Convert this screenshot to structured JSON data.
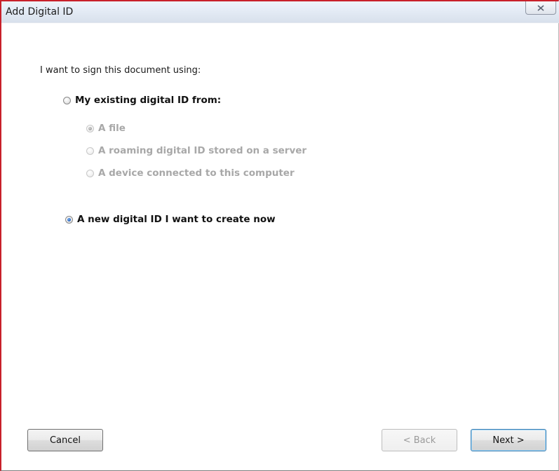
{
  "window": {
    "title": "Add Digital ID",
    "close_icon": "close-icon"
  },
  "prompt": "I want to sign this document using:",
  "options": {
    "existing": {
      "label": "My existing digital ID from:",
      "checked": false,
      "enabled": true,
      "sub_options": [
        {
          "label": "A file",
          "checked": true,
          "enabled": false
        },
        {
          "label": "A roaming digital ID stored on a server",
          "checked": false,
          "enabled": false
        },
        {
          "label": "A device connected to this computer",
          "checked": false,
          "enabled": false
        }
      ]
    },
    "new_id": {
      "label": "A new digital ID I want to create now",
      "checked": true,
      "enabled": true
    }
  },
  "buttons": {
    "cancel": "Cancel",
    "back": "< Back",
    "next": "Next >"
  },
  "colors": {
    "accent_border": "#c8202a",
    "radio_selected": "#2a69c4",
    "disabled_text": "#a8a8a8"
  }
}
